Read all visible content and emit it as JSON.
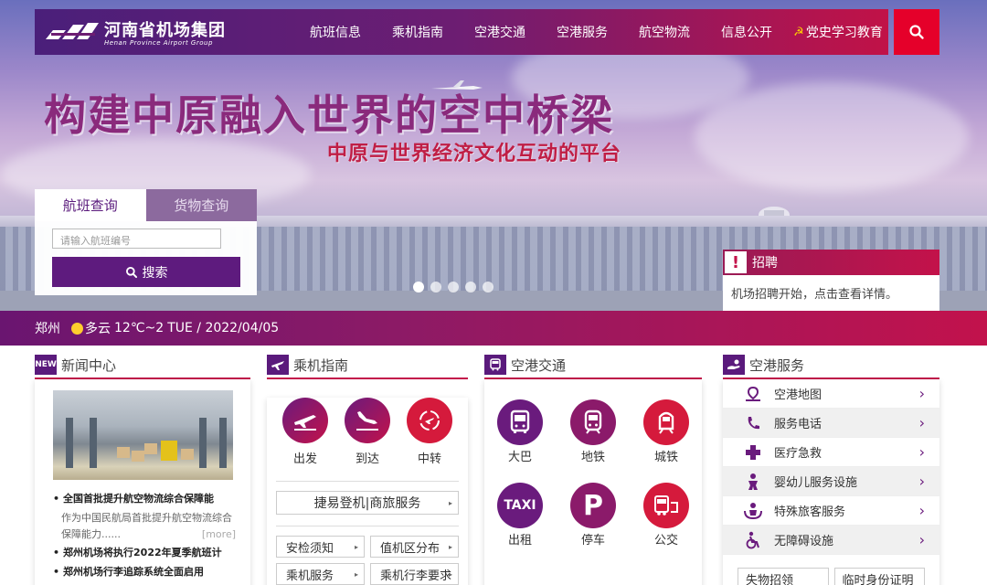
{
  "header": {
    "logo_cn": "河南省机场集团",
    "logo_en": "Henan Province Airport Group",
    "nav": [
      "航班信息",
      "乘机指南",
      "空港交通",
      "空港服务",
      "航空物流",
      "信息公开",
      "党史学习教育"
    ]
  },
  "hero": {
    "title": "构建中原融入世界的空中桥梁",
    "subtitle": "中原与世界经济文化互动的平台"
  },
  "query": {
    "tab_flight": "航班查询",
    "tab_cargo": "货物查询",
    "placeholder": "请输入航班编号",
    "search_label": "搜索"
  },
  "recruit": {
    "title": "招聘",
    "text": "机场招聘开始，点击查看详情。"
  },
  "weather": {
    "city": "郑州",
    "condition": "多云",
    "temp": "12℃~2",
    "date": "TUE / 2022/04/05"
  },
  "news": {
    "badge": "NEW",
    "title": "新闻中心",
    "items": [
      {
        "title": "全国首批提升航空物流综合保障能",
        "desc": "作为中国民航局首批提升航空物流综合保障能力......",
        "more": "[more]"
      },
      {
        "title": "郑州机场将执行2022年夏季航班计"
      },
      {
        "title": "郑州机场行李追踪系统全面启用"
      }
    ]
  },
  "guide": {
    "title": "乘机指南",
    "circles": [
      "出发",
      "到达",
      "中转"
    ],
    "wide_button": "捷易登机|商旅服务",
    "small_buttons": [
      [
        "安检须知",
        "值机区分布"
      ],
      [
        "乘机服务",
        "乘机行李要求"
      ]
    ]
  },
  "transport": {
    "title": "空港交通",
    "items": [
      "大巴",
      "地铁",
      "城铁",
      "出租",
      "停车",
      "公交"
    ],
    "taxi_text": "TAXI",
    "parking_text": "P"
  },
  "services": {
    "title": "空港服务",
    "items": [
      "空港地图",
      "服务电话",
      "医疗急救",
      "婴幼儿服务设施",
      "特殊旅客服务",
      "无障碍设施"
    ],
    "buttons": [
      "失物招领",
      "临时身份证明"
    ]
  },
  "colors": {
    "purple": "#5e1b7e",
    "red": "#c3124a"
  }
}
